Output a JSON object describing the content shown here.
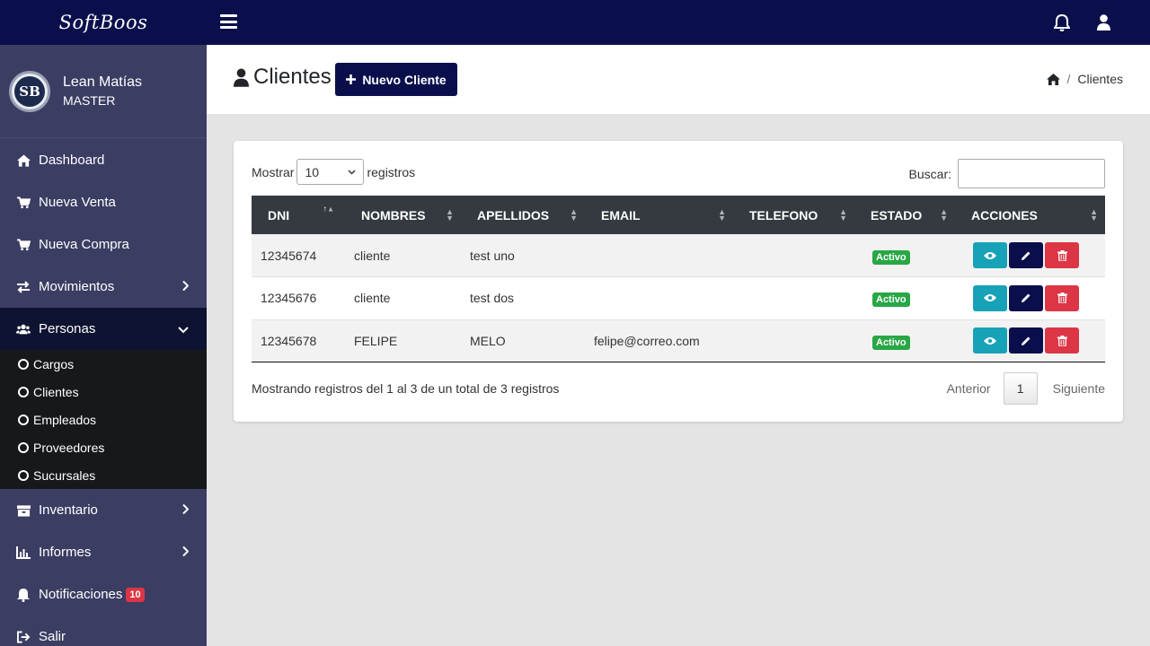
{
  "brand": "SoftBoos",
  "user": {
    "avatar_text": "SB",
    "name": "Lean Matías",
    "role": "MASTER"
  },
  "nav": {
    "dashboard": "Dashboard",
    "nueva_venta": "Nueva Venta",
    "nueva_compra": "Nueva Compra",
    "movimientos": "Movimientos",
    "personas": "Personas",
    "sub": [
      "Cargos",
      "Clientes",
      "Empleados",
      "Proveedores",
      "Sucursales"
    ],
    "inventario": "Inventario",
    "informes": "Informes",
    "notificaciones": "Notificaciones",
    "notificaciones_count": "10",
    "salir": "Salir"
  },
  "header": {
    "title": "Clientes",
    "new_button": "Nuevo Cliente",
    "breadcrumb_current": "Clientes"
  },
  "table_controls": {
    "show_label": "Mostrar",
    "length_value": "10",
    "records_label": "registros",
    "search_label": "Buscar:"
  },
  "table": {
    "columns": [
      "DNI",
      "NOMBRES",
      "APELLIDOS",
      "EMAIL",
      "TELEFONO",
      "ESTADO",
      "ACCIONES"
    ],
    "rows": [
      {
        "dni": "12345674",
        "nombres": "cliente",
        "apellidos": "test uno",
        "email": "",
        "telefono": "",
        "estado": "Activo"
      },
      {
        "dni": "12345676",
        "nombres": "cliente",
        "apellidos": "test dos",
        "email": "",
        "telefono": "",
        "estado": "Activo"
      },
      {
        "dni": "12345678",
        "nombres": "FELIPE",
        "apellidos": "MELO",
        "email": "felipe@correo.com",
        "telefono": "",
        "estado": "Activo"
      }
    ]
  },
  "footer": {
    "info": "Mostrando registros del 1 al 3 de un total de 3 registros",
    "prev": "Anterior",
    "page": "1",
    "next": "Siguiente"
  },
  "colors": {
    "navy": "#0a0f4c",
    "sidebar": "#3c3d63",
    "info": "#17a2b8",
    "danger": "#dc3545",
    "success": "#28a745"
  }
}
